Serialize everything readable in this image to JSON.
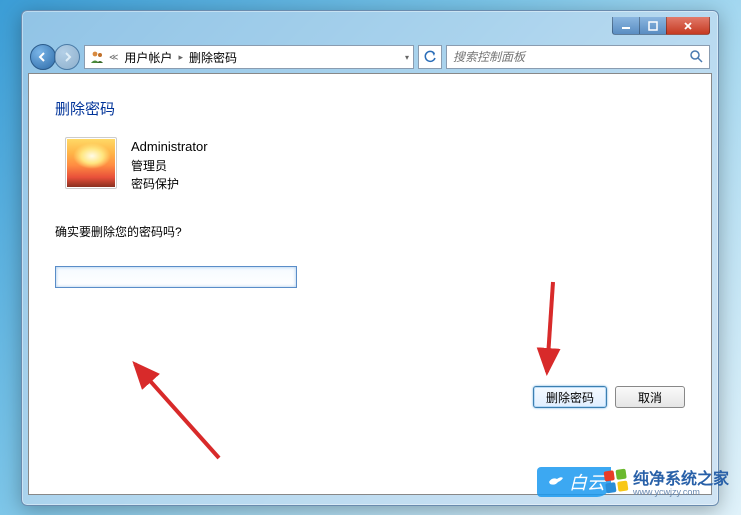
{
  "titlebar": {
    "minimize": "minimize",
    "maximize": "maximize",
    "close": "close"
  },
  "nav": {
    "back": "back",
    "forward": "forward",
    "breadcrumb": {
      "item1": "用户帐户",
      "item2": "删除密码"
    },
    "refresh": "refresh",
    "search_placeholder": "搜索控制面板"
  },
  "page": {
    "heading": "删除密码",
    "user": {
      "name": "Administrator",
      "role": "管理员",
      "protection": "密码保护"
    },
    "question": "确实要删除您的密码吗?",
    "password_value": "",
    "buttons": {
      "primary": "删除密码",
      "cancel": "取消"
    }
  },
  "watermark": {
    "brand1_text": "白云",
    "brand2_text": "纯净系统之家",
    "brand2_url": "www.ycwjzy.com"
  }
}
